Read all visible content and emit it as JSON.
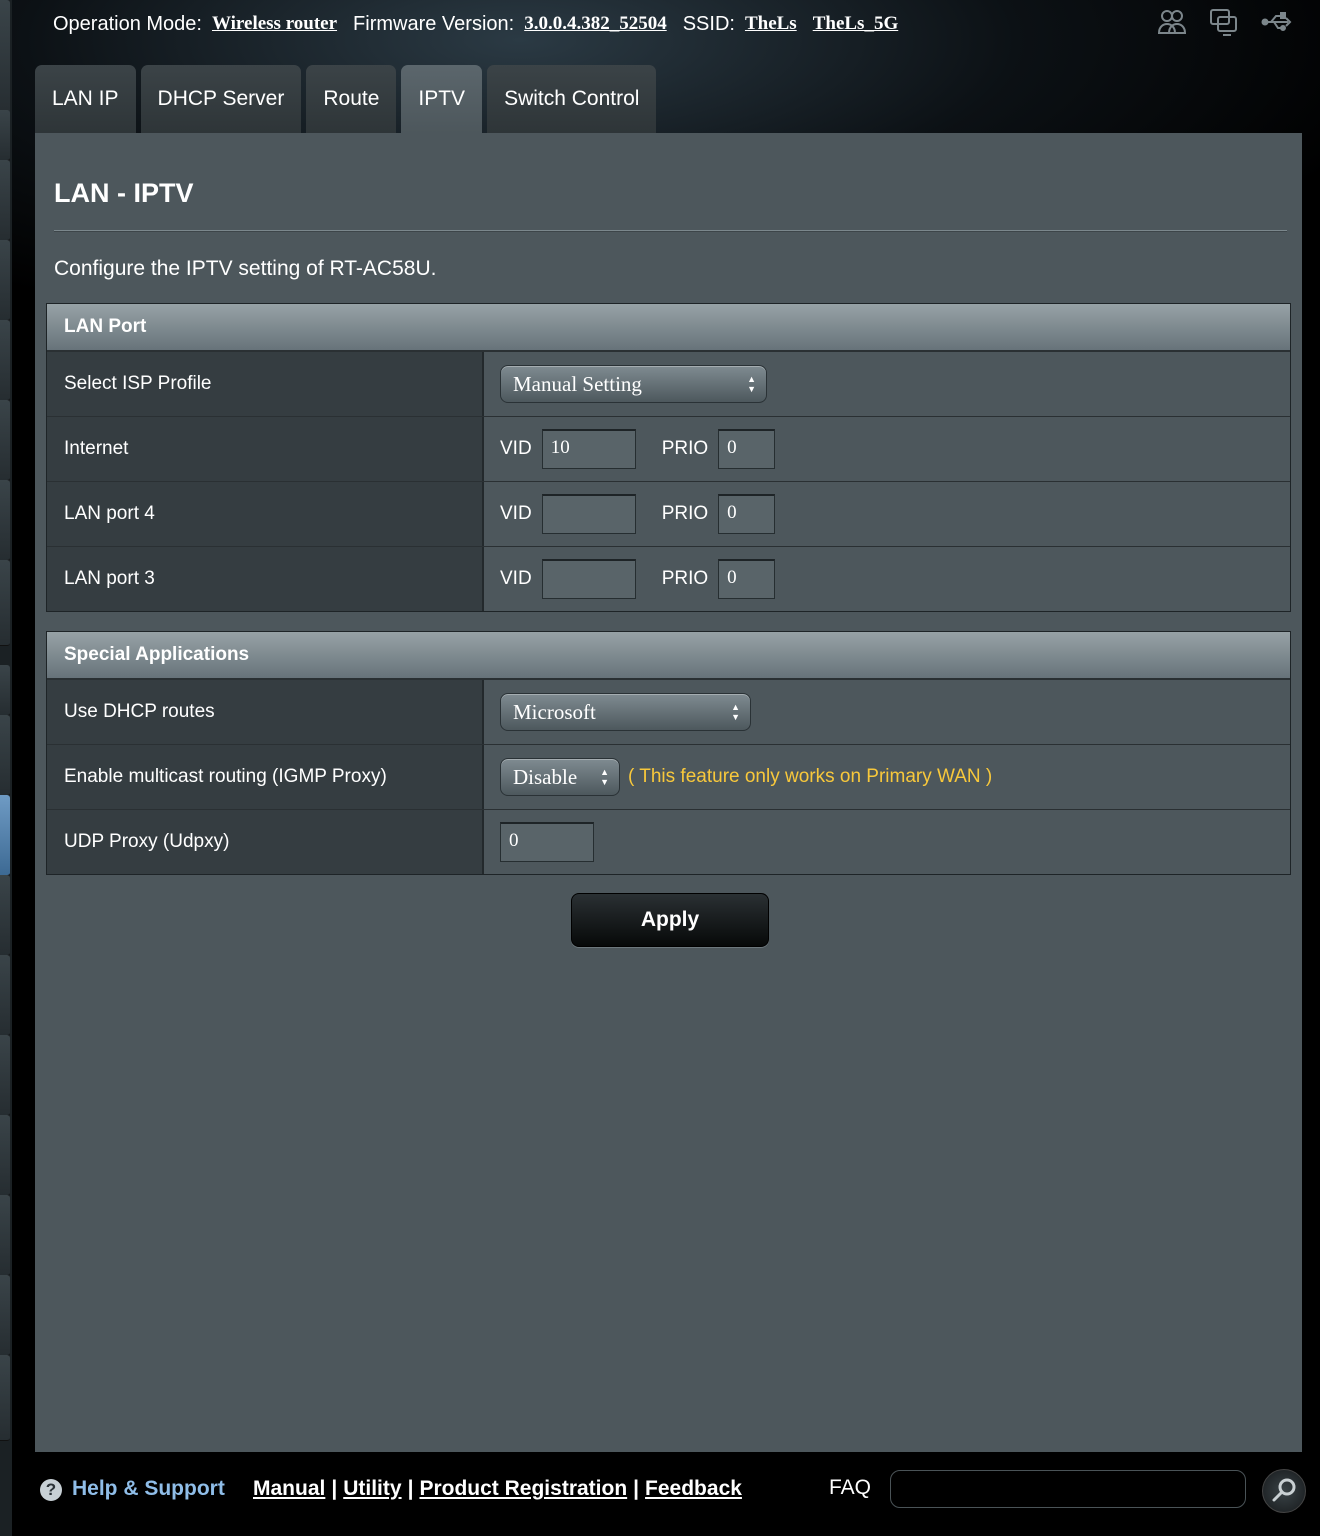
{
  "header": {
    "operation_mode_label": "Operation Mode:",
    "operation_mode_value": "Wireless router",
    "firmware_label": "Firmware Version:",
    "firmware_value": "3.0.0.4.382_52504",
    "ssid_label": "SSID:",
    "ssid_values": [
      "TheLs",
      "TheLs_5G"
    ],
    "icons": [
      "clients-icon",
      "screens-icon",
      "usb-icon"
    ]
  },
  "tabs": [
    {
      "label": "LAN IP",
      "active": false
    },
    {
      "label": "DHCP Server",
      "active": false
    },
    {
      "label": "Route",
      "active": false
    },
    {
      "label": "IPTV",
      "active": true
    },
    {
      "label": "Switch Control",
      "active": false
    }
  ],
  "page": {
    "title": "LAN - IPTV",
    "description": "Configure the IPTV setting of RT-AC58U."
  },
  "lan_port": {
    "header": "LAN Port",
    "isp_profile_label": "Select ISP Profile",
    "isp_profile_value": "Manual Setting",
    "vid_label": "VID",
    "prio_label": "PRIO",
    "rows": [
      {
        "label": "Internet",
        "vid": "10",
        "prio": "0"
      },
      {
        "label": "LAN port 4",
        "vid": "",
        "prio": "0"
      },
      {
        "label": "LAN port 3",
        "vid": "",
        "prio": "0"
      }
    ]
  },
  "special": {
    "header": "Special Applications",
    "dhcp_routes_label": "Use DHCP routes",
    "dhcp_routes_value": "Microsoft",
    "igmp_label": "Enable multicast routing (IGMP Proxy)",
    "igmp_value": "Disable",
    "igmp_note": "( This feature only works on Primary WAN )",
    "udpxy_label": "UDP Proxy (Udpxy)",
    "udpxy_value": "0"
  },
  "apply_label": "Apply",
  "footer": {
    "help": "Help & Support",
    "links": [
      "Manual",
      "Utility",
      "Product Registration",
      "Feedback"
    ],
    "faq": "FAQ"
  },
  "colors": {
    "panel": "#4d575c",
    "label_cell": "#353d41",
    "note": "#f8c83b",
    "help_link": "#8fbde8"
  }
}
